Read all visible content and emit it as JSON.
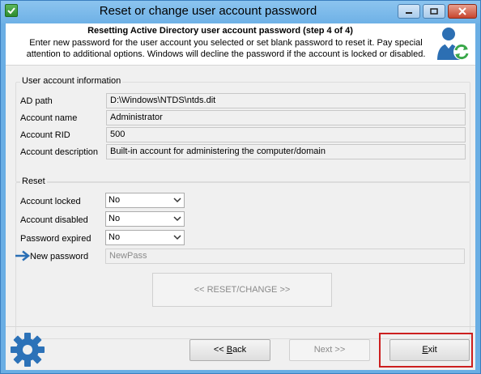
{
  "window": {
    "title": "Reset or change user account password"
  },
  "header": {
    "step_title": "Resetting Active Directory user account password (step 4 of 4)",
    "description": "Enter new password for the user account you selected or set blank password to reset it. Pay special attention to additional options. Windows will decline the password if the account is locked or disabled."
  },
  "account_info": {
    "group_title": "User account information",
    "ad_path_label": "AD path",
    "ad_path_value": "D:\\Windows\\NTDS\\ntds.dit",
    "account_name_label": "Account name",
    "account_name_value": "Administrator",
    "account_rid_label": "Account RID",
    "account_rid_value": "500",
    "account_desc_label": "Account description",
    "account_desc_value": "Built-in account for administering the computer/domain"
  },
  "reset": {
    "group_title": "Reset",
    "locked_label": "Account locked",
    "locked_value": "No",
    "disabled_label": "Account disabled",
    "disabled_value": "No",
    "expired_label": "Password expired",
    "expired_value": "No",
    "new_password_label": "New password",
    "new_password_placeholder": "NewPass",
    "reset_button_label": "<< RESET/CHANGE >>"
  },
  "footer": {
    "back_prefix": "<< ",
    "back_accel": "B",
    "back_rest": "ack",
    "next_label": "Next >>",
    "exit_accel": "E",
    "exit_rest": "xit"
  },
  "colors": {
    "title_bar": "#6eb1e6",
    "highlight": "#cc1f1f",
    "arrow": "#2a6fb5"
  },
  "icons": {
    "app": "app-icon",
    "minimize": "minimize-icon",
    "maximize": "maximize-icon",
    "close": "close-icon",
    "user_refresh": "user-refresh-icon",
    "gear": "gear-icon",
    "arrow": "right-arrow-icon",
    "dropdown": "chevron-down-icon"
  }
}
